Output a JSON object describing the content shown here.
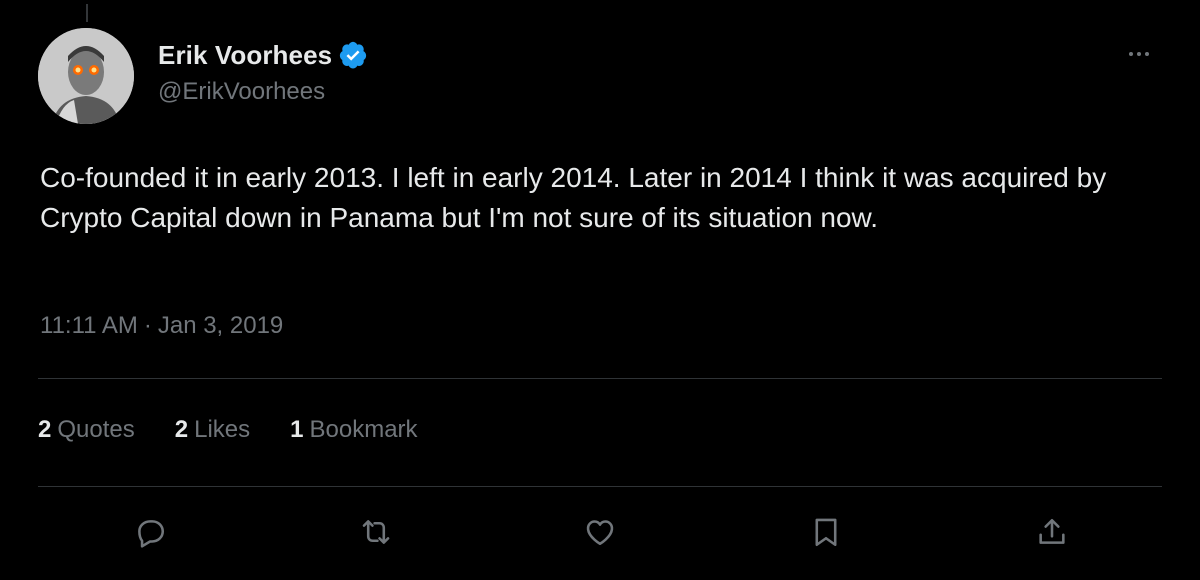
{
  "tweet": {
    "author": {
      "display_name": "Erik Voorhees",
      "handle": "@ErikVoorhees",
      "verified": true
    },
    "text": "Co-founded it in early 2013. I left in early 2014. Later in 2014 I think it was acquired by Crypto Capital down in Panama but I'm not sure of its situation now.",
    "time": "11:11 AM",
    "separator": "·",
    "date": "Jan 3, 2019",
    "stats": [
      {
        "count": "2",
        "label": "Quotes"
      },
      {
        "count": "2",
        "label": "Likes"
      },
      {
        "count": "1",
        "label": "Bookmark"
      }
    ],
    "actions": [
      "reply-icon",
      "retweet-icon",
      "like-icon",
      "bookmark-icon",
      "share-icon"
    ]
  },
  "colors": {
    "background": "#000000",
    "primary_text": "#e7e9ea",
    "secondary_text": "#71767b",
    "verified_badge": "#1d9bf0",
    "divider": "#2f3336"
  }
}
